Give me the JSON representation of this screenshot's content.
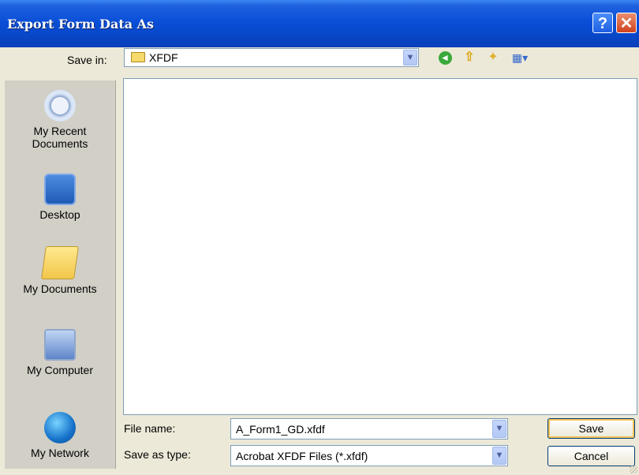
{
  "window": {
    "title": "Export Form Data As",
    "help_glyph": "?",
    "close_glyph": "✕"
  },
  "toolbar": {
    "save_in_label": "Save in:",
    "save_in_value": "XFDF",
    "dropdown_glyph": "▼",
    "back_icon": "back-icon",
    "up_icon": "up-folder-icon",
    "new_folder_icon": "new-folder-icon",
    "views_icon": "views-menu-icon"
  },
  "places": [
    {
      "label_line1": "My Recent",
      "label_line2": "Documents",
      "icon": "recent-documents-icon"
    },
    {
      "label_line1": "Desktop",
      "label_line2": "",
      "icon": "desktop-icon"
    },
    {
      "label_line1": "My Documents",
      "label_line2": "",
      "icon": "my-documents-icon"
    },
    {
      "label_line1": "My Computer",
      "label_line2": "",
      "icon": "my-computer-icon"
    },
    {
      "label_line1": "My Network",
      "label_line2": "",
      "icon": "my-network-icon"
    }
  ],
  "form": {
    "file_name_label": "File name:",
    "file_name_value": "A_Form1_GD.xfdf",
    "save_as_type_label": "Save as type:",
    "save_as_type_value": "Acrobat XFDF Files (*.xfdf)"
  },
  "buttons": {
    "save": "Save",
    "cancel": "Cancel"
  },
  "colors": {
    "titlebar": "#0a4fd8",
    "dialog_bg": "#ece9d8",
    "places_bg": "#d1cfc6",
    "field_border": "#7f9db9"
  }
}
